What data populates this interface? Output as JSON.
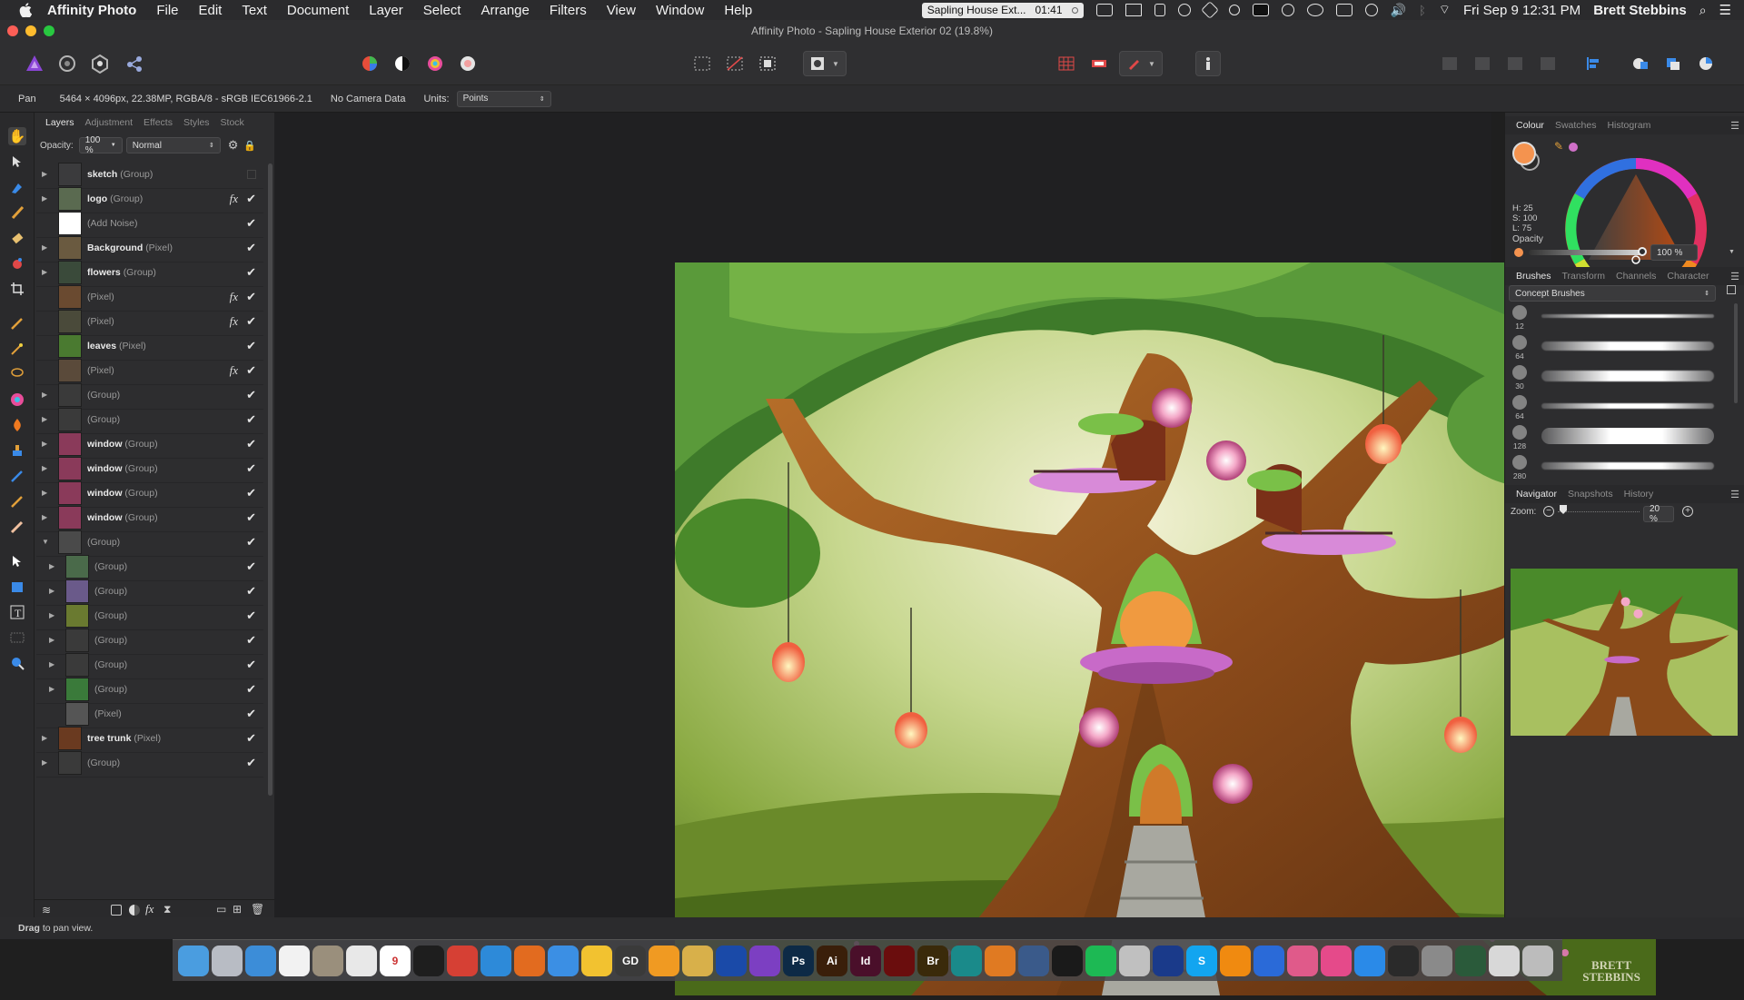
{
  "menubar": {
    "app": "Affinity Photo",
    "items": [
      "File",
      "Edit",
      "Text",
      "Document",
      "Layer",
      "Select",
      "Arrange",
      "Filters",
      "View",
      "Window",
      "Help"
    ],
    "recording_title": "Sapling House Ext...",
    "recording_time": "01:41",
    "datetime": "Fri Sep 9  12:31 PM",
    "user": "Brett Stebbins"
  },
  "window": {
    "title": "Affinity Photo - Sapling House Exterior 02 (19.8%)"
  },
  "context": {
    "tool": "Pan",
    "doc_info": "5464 × 4096px, 22.38MP, RGBA/8 - sRGB IEC61966-2.1",
    "camera": "No Camera Data",
    "units_label": "Units:",
    "units_value": "Points"
  },
  "layers_panel": {
    "tabs": [
      "Layers",
      "Adjustment",
      "Effects",
      "Styles",
      "Stock"
    ],
    "opacity_label": "Opacity:",
    "opacity_value": "100 %",
    "blend_mode": "Normal",
    "layers": [
      {
        "name": "sketch",
        "type": "(Group)",
        "expand": "▶",
        "fx": false,
        "visible": false
      },
      {
        "name": "logo",
        "type": "(Group)",
        "expand": "▶",
        "fx": true,
        "visible": true
      },
      {
        "name": "",
        "type": "(Add Noise)",
        "expand": "",
        "fx": false,
        "visible": true
      },
      {
        "name": "Background",
        "type": "(Pixel)",
        "expand": "▶",
        "fx": false,
        "visible": true
      },
      {
        "name": "flowers",
        "type": "(Group)",
        "expand": "▶",
        "fx": false,
        "visible": true
      },
      {
        "name": "",
        "type": "(Pixel)",
        "expand": "",
        "fx": true,
        "visible": true
      },
      {
        "name": "",
        "type": "(Pixel)",
        "expand": "",
        "fx": true,
        "visible": true
      },
      {
        "name": "leaves",
        "type": "(Pixel)",
        "expand": "",
        "fx": false,
        "visible": true
      },
      {
        "name": "",
        "type": "(Pixel)",
        "expand": "",
        "fx": true,
        "visible": true
      },
      {
        "name": "",
        "type": "(Group)",
        "expand": "▶",
        "fx": false,
        "visible": true
      },
      {
        "name": "",
        "type": "(Group)",
        "expand": "▶",
        "fx": false,
        "visible": true
      },
      {
        "name": "window",
        "type": "(Group)",
        "expand": "▶",
        "fx": false,
        "visible": true
      },
      {
        "name": "window",
        "type": "(Group)",
        "expand": "▶",
        "fx": false,
        "visible": true
      },
      {
        "name": "window",
        "type": "(Group)",
        "expand": "▶",
        "fx": false,
        "visible": true
      },
      {
        "name": "window",
        "type": "(Group)",
        "expand": "▶",
        "fx": false,
        "visible": true
      },
      {
        "name": "",
        "type": "(Group)",
        "expand": "▼",
        "fx": false,
        "visible": true
      },
      {
        "name": "",
        "type": "(Group)",
        "expand": "▶",
        "fx": false,
        "visible": true
      },
      {
        "name": "",
        "type": "(Group)",
        "expand": "▶",
        "fx": false,
        "visible": true
      },
      {
        "name": "",
        "type": "(Group)",
        "expand": "▶",
        "fx": false,
        "visible": true
      },
      {
        "name": "",
        "type": "(Group)",
        "expand": "▶",
        "fx": false,
        "visible": true
      },
      {
        "name": "",
        "type": "(Group)",
        "expand": "▶",
        "fx": false,
        "visible": true
      },
      {
        "name": "",
        "type": "(Group)",
        "expand": "▶",
        "fx": false,
        "visible": true
      },
      {
        "name": "",
        "type": "(Pixel)",
        "expand": "",
        "fx": false,
        "visible": true
      },
      {
        "name": "tree trunk",
        "type": "(Pixel)",
        "expand": "▶",
        "fx": false,
        "visible": true
      },
      {
        "name": "",
        "type": "(Group)",
        "expand": "▶",
        "fx": false,
        "visible": true
      }
    ]
  },
  "colour_panel": {
    "tabs": [
      "Colour",
      "Swatches",
      "Histogram"
    ],
    "h": "H: 25",
    "s": "S: 100",
    "l": "L: 75",
    "opacity_label": "Opacity",
    "opacity_value": "100 %",
    "primary_color": "#f4934f",
    "secondary_color": "#2a2a2a"
  },
  "brushes_panel": {
    "tabs": [
      "Brushes",
      "Transform",
      "Channels",
      "Character"
    ],
    "category": "Concept Brushes",
    "brushes": [
      {
        "size": "12"
      },
      {
        "size": "64"
      },
      {
        "size": "30"
      },
      {
        "size": "64"
      },
      {
        "size": "128"
      },
      {
        "size": "280"
      }
    ]
  },
  "navigator_panel": {
    "tabs": [
      "Navigator",
      "Snapshots",
      "History"
    ],
    "zoom_label": "Zoom:",
    "zoom_value": "20 %"
  },
  "artwork": {
    "signature": "BRETT STEBBINS"
  },
  "status": {
    "bold": "Drag",
    "text": " to pan view."
  },
  "dock": {
    "apps": [
      {
        "name": "Finder",
        "label": "",
        "color": "#4a9de0"
      },
      {
        "name": "Launchpad",
        "label": "",
        "color": "#b8bcc4"
      },
      {
        "name": "Skype Mail",
        "label": "",
        "color": "#3c8dd8"
      },
      {
        "name": "Notes",
        "label": "",
        "color": "#f2f2f2"
      },
      {
        "name": "Archive",
        "label": "",
        "color": "#9a8f7c"
      },
      {
        "name": "Editor",
        "label": "",
        "color": "#e8e8e8"
      },
      {
        "name": "Calendar",
        "label": "9",
        "color": "#ffffff"
      },
      {
        "name": "Dashboard",
        "label": "",
        "color": "#1e1e1e"
      },
      {
        "name": "Bookmark",
        "label": "",
        "color": "#d64034"
      },
      {
        "name": "Photos",
        "label": "",
        "color": "#2d8ad9"
      },
      {
        "name": "Firefox",
        "label": "",
        "color": "#e26b1f"
      },
      {
        "name": "Safari",
        "label": "",
        "color": "#3b8fe4"
      },
      {
        "name": "Chrome",
        "label": "",
        "color": "#f2c230"
      },
      {
        "name": "GD",
        "label": "GD",
        "color": "#3a3a3a"
      },
      {
        "name": "Sketch",
        "label": "",
        "color": "#f09a22"
      },
      {
        "name": "Pencil",
        "label": "",
        "color": "#d8b04a"
      },
      {
        "name": "Affinity Designer",
        "label": "",
        "color": "#1a4aa8"
      },
      {
        "name": "Affinity Photo",
        "label": "",
        "color": "#7c3fc2"
      },
      {
        "name": "Photoshop",
        "label": "Ps",
        "color": "#0d2a46"
      },
      {
        "name": "Illustrator",
        "label": "Ai",
        "color": "#3a1f0a"
      },
      {
        "name": "InDesign",
        "label": "Id",
        "color": "#4a0f2a"
      },
      {
        "name": "Acrobat",
        "label": "",
        "color": "#6a0d0d"
      },
      {
        "name": "Bridge",
        "label": "Br",
        "color": "#3a2a0a"
      },
      {
        "name": "Maya",
        "label": "",
        "color": "#1a8a8a"
      },
      {
        "name": "Blender",
        "label": "",
        "color": "#e07a22"
      },
      {
        "name": "Poser",
        "label": "",
        "color": "#3a5a8a"
      },
      {
        "name": "Steam",
        "label": "",
        "color": "#1a1a1a"
      },
      {
        "name": "Spotify",
        "label": "",
        "color": "#1db954"
      },
      {
        "name": "Utility",
        "label": "",
        "color": "#c0c0c0"
      },
      {
        "name": "Search",
        "label": "",
        "color": "#1a3a8a"
      },
      {
        "name": "Skype",
        "label": "S",
        "color": "#12a5f0"
      },
      {
        "name": "VLC",
        "label": "",
        "color": "#f08a10"
      },
      {
        "name": "QuickTime",
        "label": "",
        "color": "#2a6ad8"
      },
      {
        "name": "Photos App",
        "label": "",
        "color": "#e05a8a"
      },
      {
        "name": "iTunes",
        "label": "",
        "color": "#e54a8a"
      },
      {
        "name": "App Store",
        "label": "",
        "color": "#2a8ae8"
      },
      {
        "name": "Activity Monitor",
        "label": "",
        "color": "#2a2a2a"
      },
      {
        "name": "System Preferences",
        "label": "",
        "color": "#8a8a8a"
      },
      {
        "name": "Camtasia",
        "label": "",
        "color": "#2a5a3a"
      },
      {
        "name": "Documents",
        "label": "",
        "color": "#d8d8d8"
      },
      {
        "name": "Trash",
        "label": "",
        "color": "#bcbcbc"
      }
    ]
  }
}
